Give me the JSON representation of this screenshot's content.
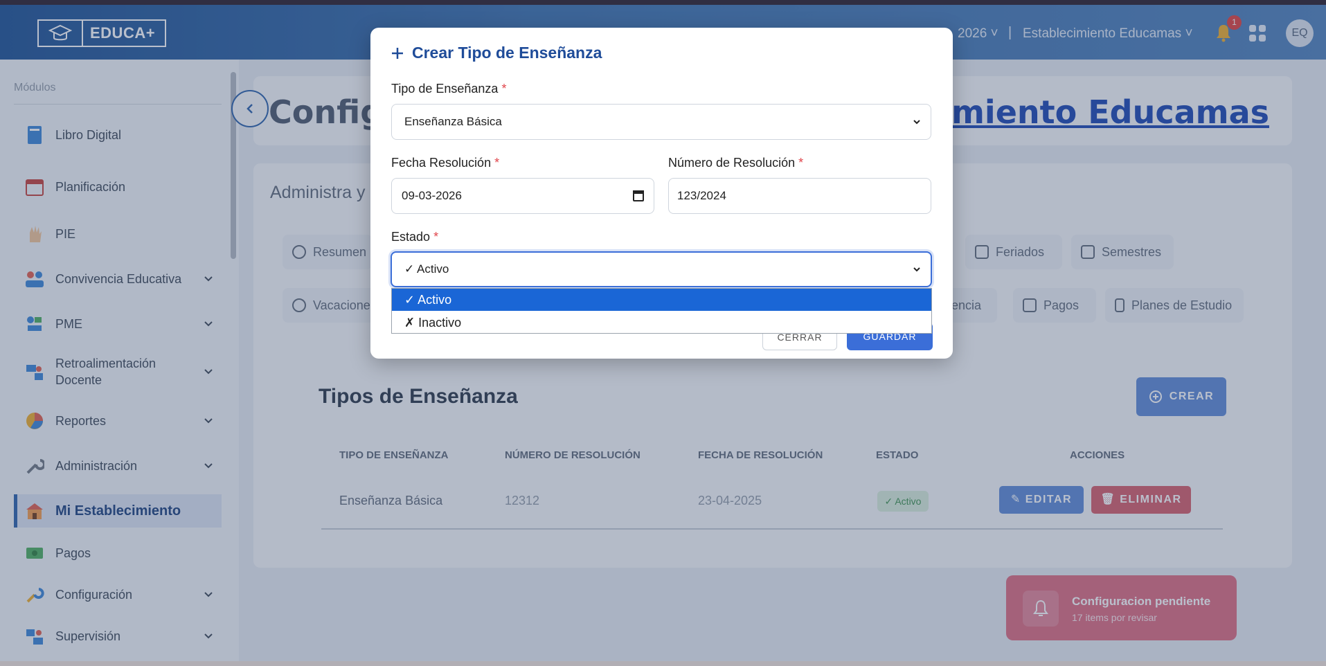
{
  "header": {
    "logo_text": "EDUCA+",
    "year": "2026",
    "separator": "|",
    "establishment": "Establecimiento Educamas",
    "notification_count": "1",
    "avatar_initials": "EQ"
  },
  "sidebar": {
    "title": "Módulos",
    "items": [
      {
        "label": "Libro Digital",
        "icon": "book-icon"
      },
      {
        "label": "Planificación",
        "icon": "calendar-icon"
      },
      {
        "label": "PIE",
        "icon": "hand-icon"
      },
      {
        "label": "Convivencia Educativa",
        "icon": "people-icon"
      },
      {
        "label": "PME",
        "icon": "chart-icon"
      },
      {
        "label": "Retroalimentación Docente",
        "icon": "teacher-icon"
      },
      {
        "label": "Reportes",
        "icon": "pie-icon"
      },
      {
        "label": "Administración",
        "icon": "wrench-icon"
      },
      {
        "label": "Mi Establecimiento",
        "icon": "school-icon"
      },
      {
        "label": "Pagos",
        "icon": "money-icon"
      },
      {
        "label": "Configuración",
        "icon": "tools-icon"
      },
      {
        "label": "Supervisión",
        "icon": "supervisor-icon"
      }
    ]
  },
  "page": {
    "title_left": "Config",
    "title_right": "miento Educamas",
    "subtitle": "Administra y"
  },
  "tabs": {
    "resumen": "Resumen",
    "feriados": "Feriados",
    "semestres": "Semestres",
    "vacaciones": "Vacacione",
    "asistencia": "stencia",
    "pagos": "Pagos",
    "planes": "Planes de Estudio"
  },
  "table": {
    "title": "Tipos de Enseñanza",
    "create_label": "CREAR",
    "headers": [
      "TIPO DE ENSEÑANZA",
      "NÚMERO DE RESOLUCIÓN",
      "FECHA DE RESOLUCIÓN",
      "ESTADO",
      "ACCIONES"
    ],
    "rows": [
      {
        "tipo": "Enseñanza Básica",
        "numero": "12312",
        "fecha": "23-04-2025",
        "estado": "✓ Activo",
        "edit": "EDITAR",
        "delete": "ELIMINAR"
      }
    ]
  },
  "toast": {
    "title": "Configuracion pendiente",
    "subtitle": "17 items por revisar"
  },
  "modal": {
    "title": "Crear Tipo de Enseñanza",
    "tipo_label": "Tipo de Enseñanza",
    "tipo_value": "Enseñanza Básica",
    "fecha_label": "Fecha Resolución",
    "fecha_value": "09-03-2026",
    "numero_label": "Número de Resolución",
    "numero_value": "123/2024",
    "estado_label": "Estado",
    "estado_value": "✓ Activo",
    "required_mark": "*",
    "cerrar_label": "CERRAR",
    "guardar_label": "GUARDAR",
    "estado_options": [
      "✓ Activo",
      "✗ Inactivo"
    ]
  },
  "colors": {
    "primary": "#3b6ed8",
    "header": "#4a7bb3",
    "danger": "#d96a76"
  }
}
